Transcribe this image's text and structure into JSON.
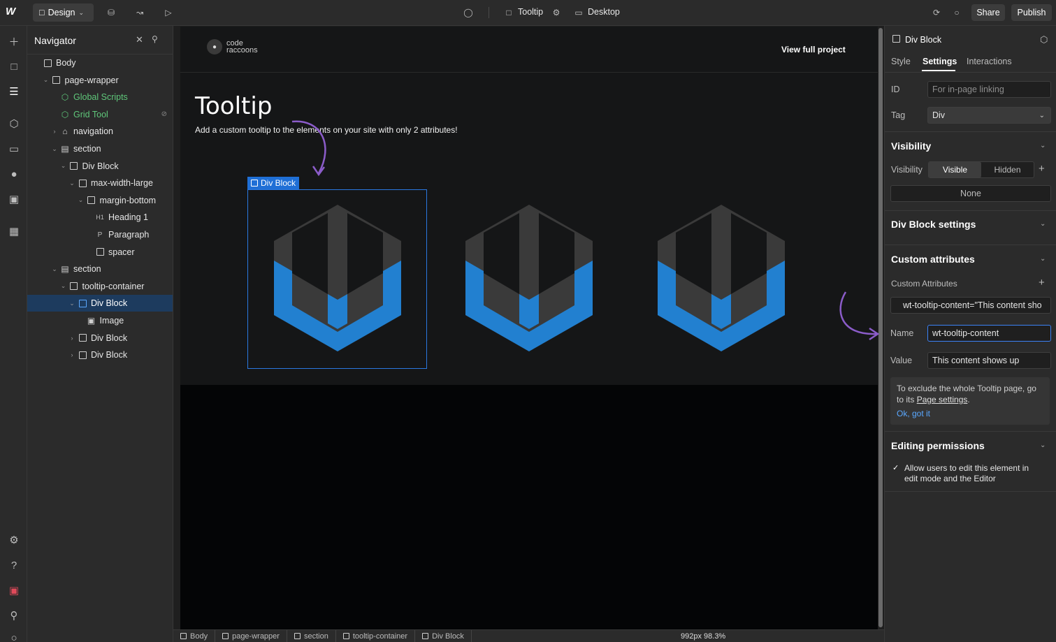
{
  "topbar": {
    "mode_label": "Design",
    "page_name": "Tooltip",
    "breakpoint_label": "Desktop",
    "share_label": "Share",
    "publish_label": "Publish"
  },
  "navigator": {
    "title": "Navigator",
    "tree": [
      {
        "label": "Body",
        "icon": "square-icon",
        "indent": 0,
        "chevron": ""
      },
      {
        "label": "page-wrapper",
        "icon": "square-icon",
        "indent": 1,
        "chevron": "v"
      },
      {
        "label": "Global Scripts",
        "icon": "component-icon",
        "indent": 2,
        "chevron": "",
        "green": true
      },
      {
        "label": "Grid Tool",
        "icon": "component-icon",
        "indent": 2,
        "chevron": "",
        "green": true,
        "hidden": true
      },
      {
        "label": "navigation",
        "icon": "home-icon",
        "indent": 2,
        "chevron": ">"
      },
      {
        "label": "section",
        "icon": "section-icon",
        "indent": 2,
        "chevron": "v"
      },
      {
        "label": "Div Block",
        "icon": "square-icon",
        "indent": 3,
        "chevron": "v"
      },
      {
        "label": "max-width-large",
        "icon": "square-icon",
        "indent": 4,
        "chevron": "v"
      },
      {
        "label": "margin-bottom",
        "icon": "square-icon",
        "indent": 5,
        "chevron": "v"
      },
      {
        "label": "Heading 1",
        "icon": "h1-icon",
        "indent": 6,
        "chevron": ""
      },
      {
        "label": "Paragraph",
        "icon": "p-icon",
        "indent": 6,
        "chevron": ""
      },
      {
        "label": "spacer",
        "icon": "square-icon",
        "indent": 6,
        "chevron": ""
      },
      {
        "label": "section",
        "icon": "section-icon",
        "indent": 2,
        "chevron": "v"
      },
      {
        "label": "tooltip-container",
        "icon": "square-icon",
        "indent": 3,
        "chevron": "v"
      },
      {
        "label": "Div Block",
        "icon": "square-icon",
        "indent": 4,
        "chevron": "v",
        "selected": true
      },
      {
        "label": "Image",
        "icon": "image-icon",
        "indent": 5,
        "chevron": ""
      },
      {
        "label": "Div Block",
        "icon": "square-icon",
        "indent": 4,
        "chevron": ">"
      },
      {
        "label": "Div Block",
        "icon": "square-icon",
        "indent": 4,
        "chevron": ">"
      }
    ]
  },
  "canvas": {
    "brand_text": "code raccoons",
    "view_full_project": "View full project",
    "heading": "Tooltip",
    "paragraph": "Add a custom tooltip to the elements on your site with only 2 attributes!",
    "selected_label": "Div Block",
    "accent": "#1f6fd6",
    "hex_blue": "#2280d0",
    "hex_gray": "#3a3a3a",
    "arrow_color": "#8b5cc9"
  },
  "bottombar": {
    "crumbs": [
      "Body",
      "page-wrapper",
      "section",
      "tooltip-container",
      "Div Block"
    ],
    "size": "992px 98.3%"
  },
  "panel": {
    "element_name": "Div Block",
    "tabs": [
      "Style",
      "Settings",
      "Interactions"
    ],
    "id_label": "ID",
    "id_placeholder": "For in-page linking",
    "tag_label": "Tag",
    "tag_value": "Div",
    "visibility_head": "Visibility",
    "visibility_label": "Visibility",
    "visible": "Visible",
    "hidden": "Hidden",
    "none": "None",
    "divblock_settings": "Div Block settings",
    "custom_attrs_head": "Custom attributes",
    "custom_attrs_label": "Custom Attributes",
    "attr_summary": "wt-tooltip-content=\"This content sho",
    "name_label": "Name",
    "name_value": "wt-tooltip-content",
    "value_label": "Value",
    "value_value": "This content shows up",
    "note_line1": "To exclude the whole Tooltip page, go to its ",
    "note_link": "Page settings",
    "note_line2": ".",
    "note_ok": "Ok, got it",
    "editing_head": "Editing permissions",
    "allow_text": "Allow users to edit this element in edit mode and the Editor"
  }
}
